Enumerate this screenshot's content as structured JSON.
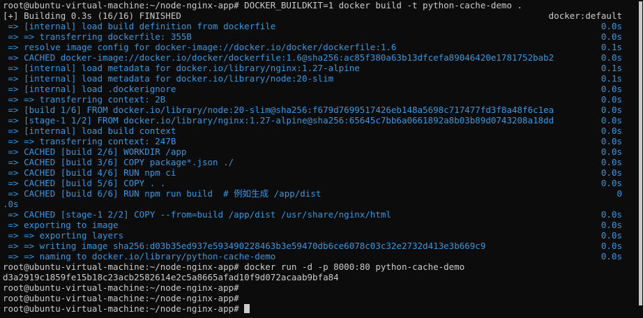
{
  "terminal": {
    "lines": [
      {
        "kind": "prompt",
        "text": "root@ubuntu-virtual-machine:~/node-nginx-app# DOCKER_BUILDKIT=1 docker build -t python-cache-demo ."
      },
      {
        "kind": "plain",
        "text": "[+] Building 0.3s (16/16) FINISHED",
        "right": "docker:default"
      },
      {
        "kind": "step",
        "text": " => [internal] load build definition from dockerfile",
        "right": "0.0s"
      },
      {
        "kind": "step",
        "text": " => => transferring dockerfile: 355B",
        "right": "0.0s"
      },
      {
        "kind": "step",
        "text": " => resolve image config for docker-image://docker.io/docker/dockerfile:1.6",
        "right": "0.1s"
      },
      {
        "kind": "step",
        "text": " => CACHED docker-image://docker.io/docker/dockerfile:1.6@sha256:ac85f380a63b13dfcefa89046420e1781752bab2",
        "right": "0.0s"
      },
      {
        "kind": "step",
        "text": " => [internal] load metadata for docker.io/library/nginx:1.27-alpine",
        "right": "0.1s"
      },
      {
        "kind": "step",
        "text": " => [internal] load metadata for docker.io/library/node:20-slim",
        "right": "0.1s"
      },
      {
        "kind": "step",
        "text": " => [internal] load .dockerignore",
        "right": "0.0s"
      },
      {
        "kind": "step",
        "text": " => => transferring context: 2B",
        "right": "0.0s"
      },
      {
        "kind": "step",
        "text": " => [build 1/6] FROM docker.io/library/node:20-slim@sha256:f679d7699517426eb148a5698c717477fd3f8a48f6c1ea",
        "right": "0.0s"
      },
      {
        "kind": "step",
        "text": " => [stage-1 1/2] FROM docker.io/library/nginx:1.27-alpine@sha256:65645c7bb6a0661892a8b03b89d0743208a18dd",
        "right": "0.0s"
      },
      {
        "kind": "step",
        "text": " => [internal] load build context",
        "right": "0.0s"
      },
      {
        "kind": "step",
        "text": " => => transferring context: 247B",
        "right": "0.0s"
      },
      {
        "kind": "step",
        "text": " => CACHED [build 2/6] WORKDIR /app",
        "right": "0.0s"
      },
      {
        "kind": "step",
        "text": " => CACHED [build 3/6] COPY package*.json ./",
        "right": "0.0s"
      },
      {
        "kind": "step",
        "text": " => CACHED [build 4/6] RUN npm ci",
        "right": "0.0s"
      },
      {
        "kind": "step",
        "text": " => CACHED [build 5/6] COPY . .",
        "right": "0.0s"
      },
      {
        "kind": "step",
        "text": " => CACHED [build 6/6] RUN npm run build  # 例如生成 /app/dist",
        "right": "0"
      },
      {
        "kind": "step",
        "text": ".0s",
        "right": ""
      },
      {
        "kind": "step",
        "text": " => CACHED [stage-1 2/2] COPY --from=build /app/dist /usr/share/nginx/html",
        "right": "0.0s"
      },
      {
        "kind": "step",
        "text": " => exporting to image",
        "right": "0.0s"
      },
      {
        "kind": "step",
        "text": " => => exporting layers",
        "right": "0.0s"
      },
      {
        "kind": "step",
        "text": " => => writing image sha256:d03b35ed937e593490228463b3e59470db6ce6078c03c32e2732d413e3b669c9",
        "right": "0.0s"
      },
      {
        "kind": "step",
        "text": " => => naming to docker.io/library/python-cache-demo",
        "right": "0.0s"
      },
      {
        "kind": "prompt",
        "text": "root@ubuntu-virtual-machine:~/node-nginx-app# docker run -d -p 8000:80 python-cache-demo"
      },
      {
        "kind": "plain",
        "text": "d3a2919c1859fe15b18c23acb2582614e2c5a8665afad10f9d072acaab9bfa84"
      },
      {
        "kind": "prompt",
        "text": "root@ubuntu-virtual-machine:~/node-nginx-app#"
      },
      {
        "kind": "prompt",
        "text": "root@ubuntu-virtual-machine:~/node-nginx-app#"
      },
      {
        "kind": "prompt",
        "text": "root@ubuntu-virtual-machine:~/node-nginx-app# ",
        "cursor": true
      }
    ]
  },
  "colors": {
    "background": "#0c0c0c",
    "foreground": "#cccccc",
    "build_step": "#3a96dd"
  }
}
